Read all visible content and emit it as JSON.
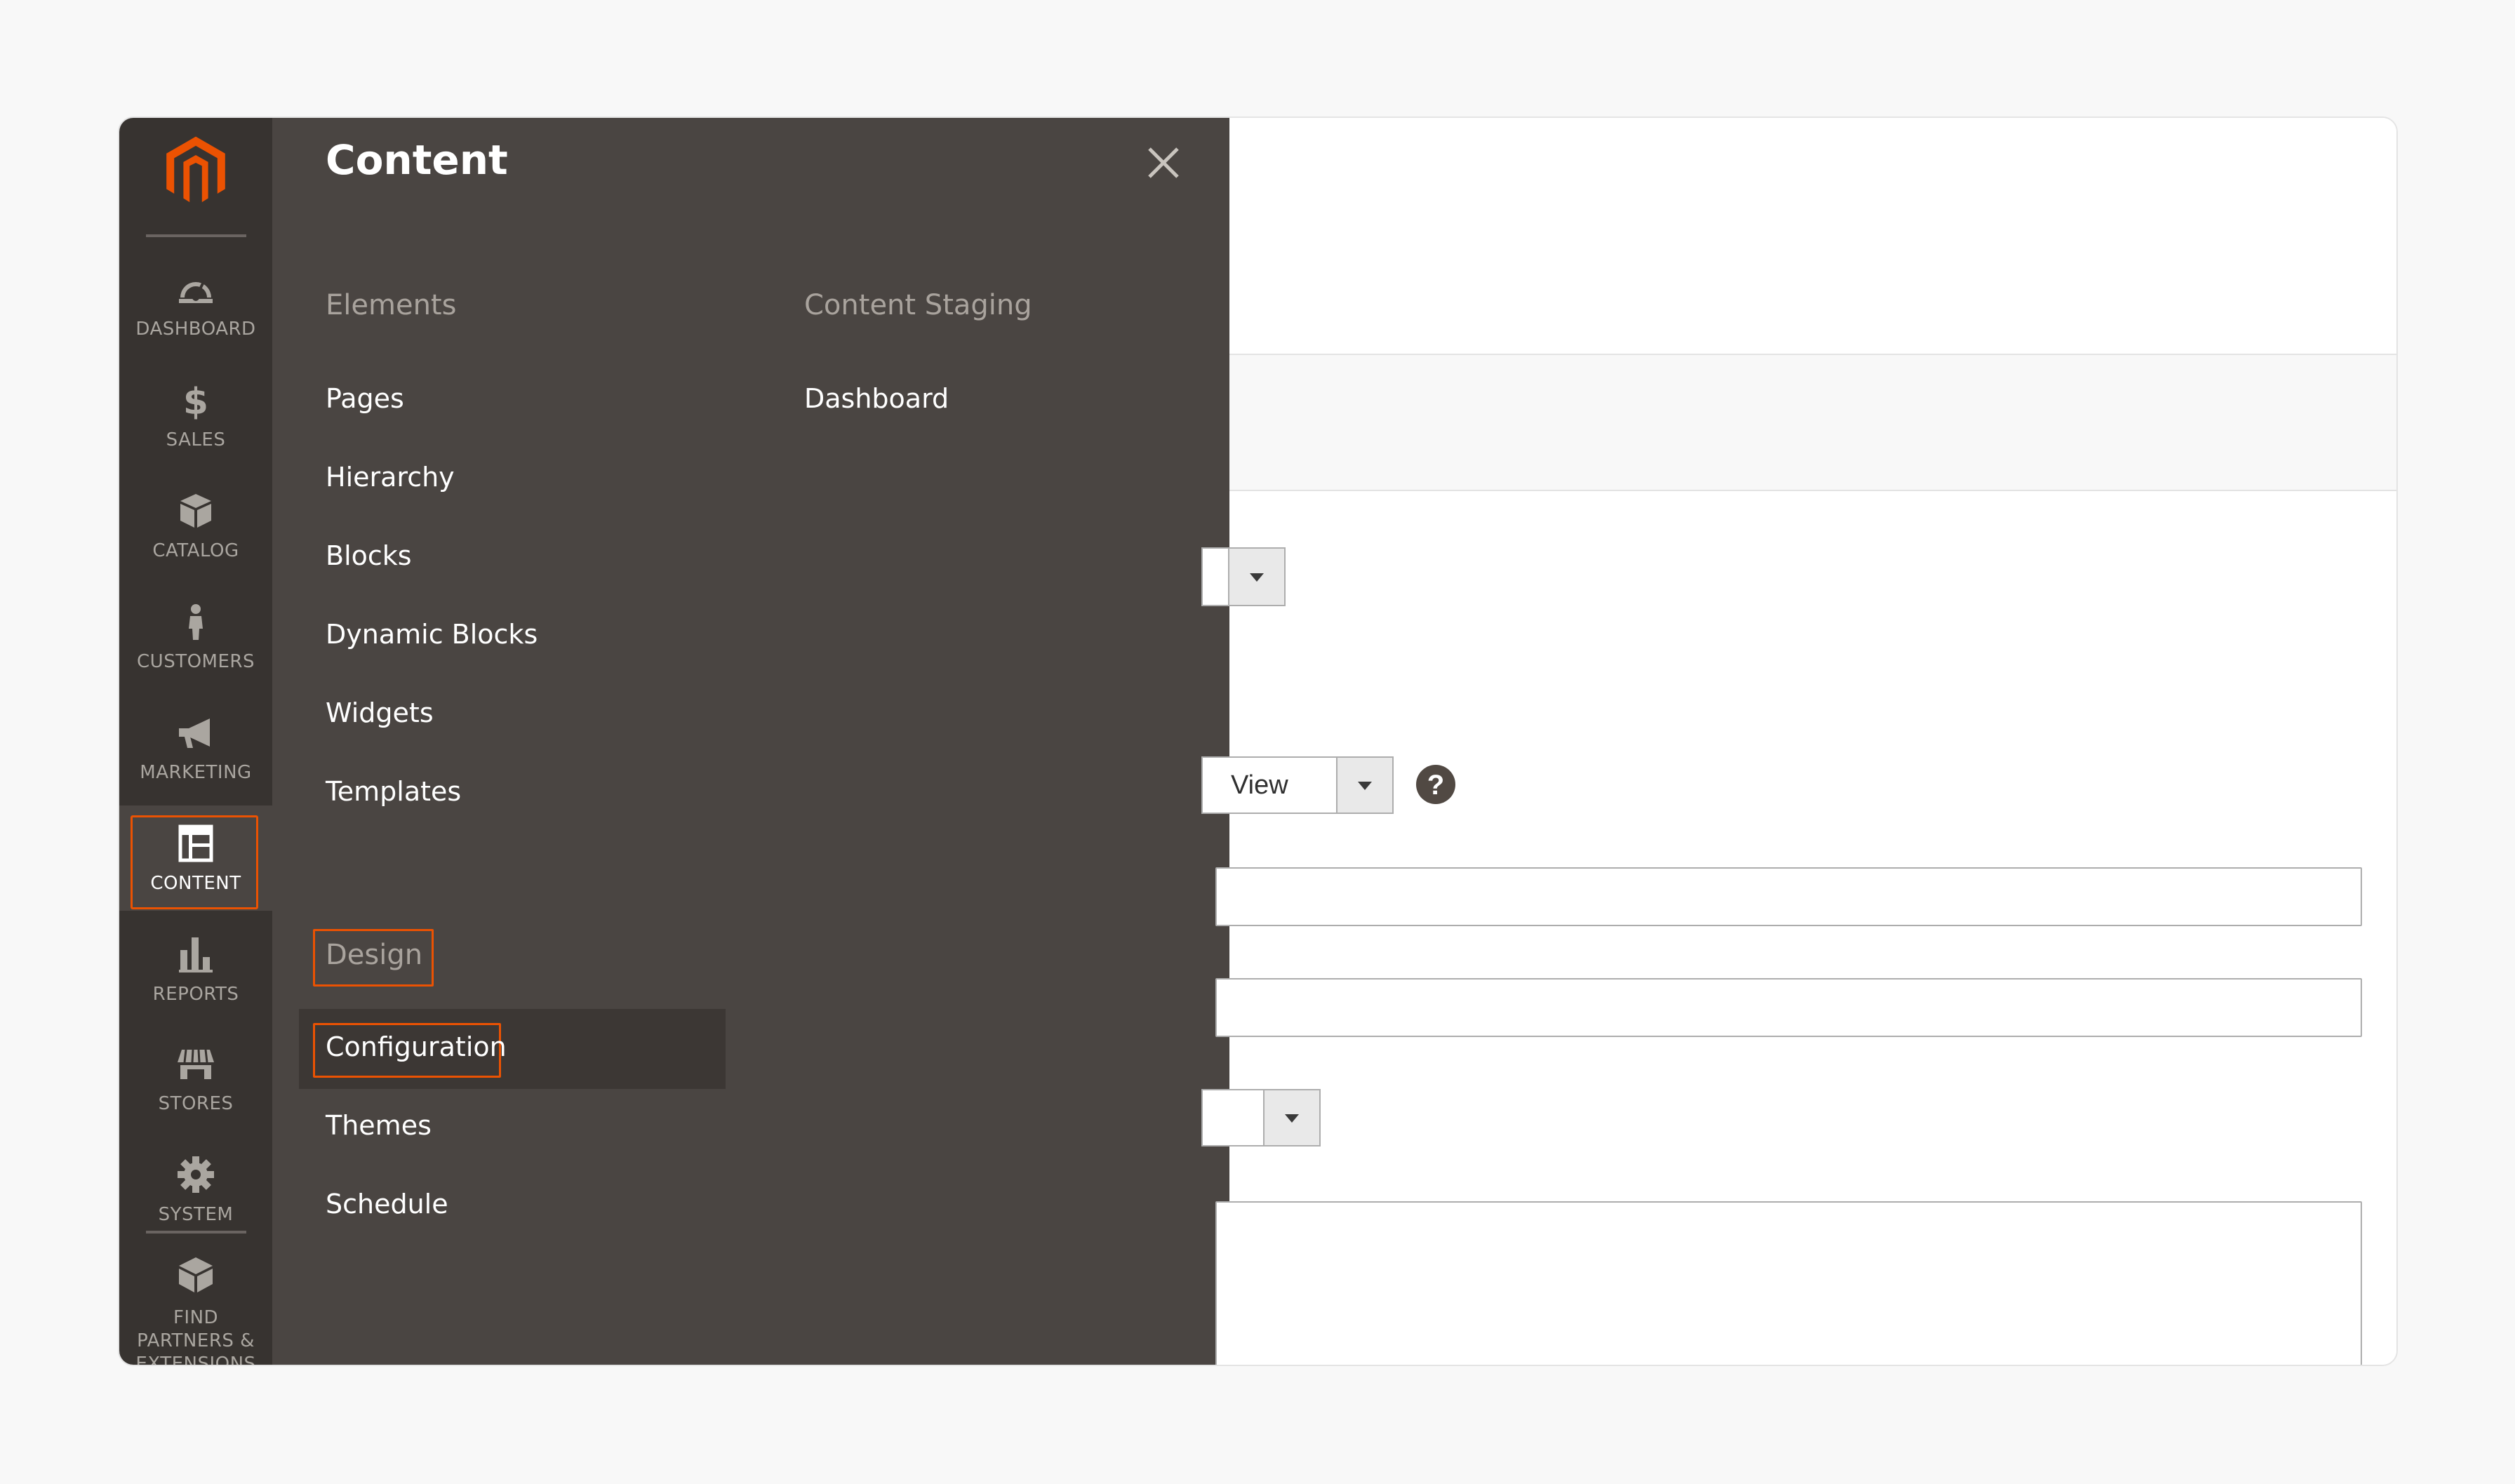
{
  "nav": {
    "items": [
      {
        "label": "DASHBOARD",
        "icon": "dashboard-icon"
      },
      {
        "label": "SALES",
        "icon": "dollar-icon"
      },
      {
        "label": "CATALOG",
        "icon": "box-icon"
      },
      {
        "label": "CUSTOMERS",
        "icon": "person-icon"
      },
      {
        "label": "MARKETING",
        "icon": "megaphone-icon"
      },
      {
        "label": "CONTENT",
        "icon": "layout-icon",
        "active": true
      },
      {
        "label": "REPORTS",
        "icon": "bar-chart-icon"
      },
      {
        "label": "STORES",
        "icon": "storefront-icon"
      },
      {
        "label": "SYSTEM",
        "icon": "gear-icon"
      },
      {
        "label": "FIND PARTNERS & EXTENSIONS",
        "icon": "cube-icon"
      }
    ]
  },
  "flyout": {
    "title": "Content",
    "elements": {
      "heading": "Elements",
      "links": [
        "Pages",
        "Hierarchy",
        "Blocks",
        "Dynamic Blocks",
        "Widgets",
        "Templates"
      ]
    },
    "content_staging": {
      "heading": "Content Staging",
      "links": [
        "Dashboard"
      ]
    },
    "design": {
      "heading": "Design",
      "links": [
        "Configuration",
        "Themes",
        "Schedule"
      ]
    }
  },
  "form": {
    "view_select_value": "View",
    "help_glyph": "?"
  },
  "colors": {
    "accent": "#eb5202",
    "nav_bg": "#373330",
    "flyout_bg": "#4a4542"
  }
}
